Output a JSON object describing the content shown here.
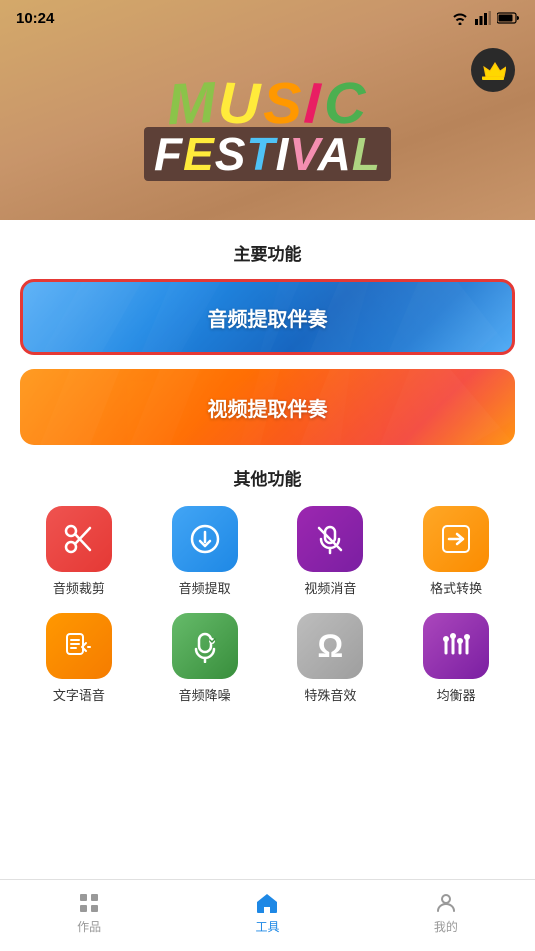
{
  "status": {
    "time": "10:24"
  },
  "banner": {
    "music_text": "MUSIC",
    "festival_text": "FESTIVAL"
  },
  "main": {
    "section_main_title": "主要功能",
    "btn_audio_label": "音频提取伴奏",
    "btn_video_label": "视频提取伴奏",
    "section_other_title": "其他功能",
    "icons": [
      {
        "id": "audio-cut",
        "label": "音频裁剪",
        "color_class": "icon-red",
        "symbol": "✂"
      },
      {
        "id": "audio-extract",
        "label": "音频提取",
        "color_class": "icon-blue",
        "symbol": "⬇"
      },
      {
        "id": "video-mute",
        "label": "视频消音",
        "color_class": "icon-purple",
        "symbol": "🎤"
      },
      {
        "id": "format-convert",
        "label": "格式转换",
        "color_class": "icon-orange",
        "symbol": "🔄"
      },
      {
        "id": "text-voice",
        "label": "文字语音",
        "color_class": "icon-orange2",
        "symbol": "📝"
      },
      {
        "id": "audio-denoise",
        "label": "音频降噪",
        "color_class": "icon-green",
        "symbol": "🎙"
      },
      {
        "id": "special-effect",
        "label": "特殊音效",
        "color_class": "icon-gray",
        "symbol": "Ω"
      },
      {
        "id": "equalizer",
        "label": "均衡器",
        "color_class": "icon-dpurple",
        "symbol": "🎛"
      }
    ]
  },
  "nav": {
    "items": [
      {
        "id": "works",
        "label": "作品",
        "active": false
      },
      {
        "id": "tools",
        "label": "工具",
        "active": true
      },
      {
        "id": "mine",
        "label": "我的",
        "active": false
      }
    ]
  }
}
